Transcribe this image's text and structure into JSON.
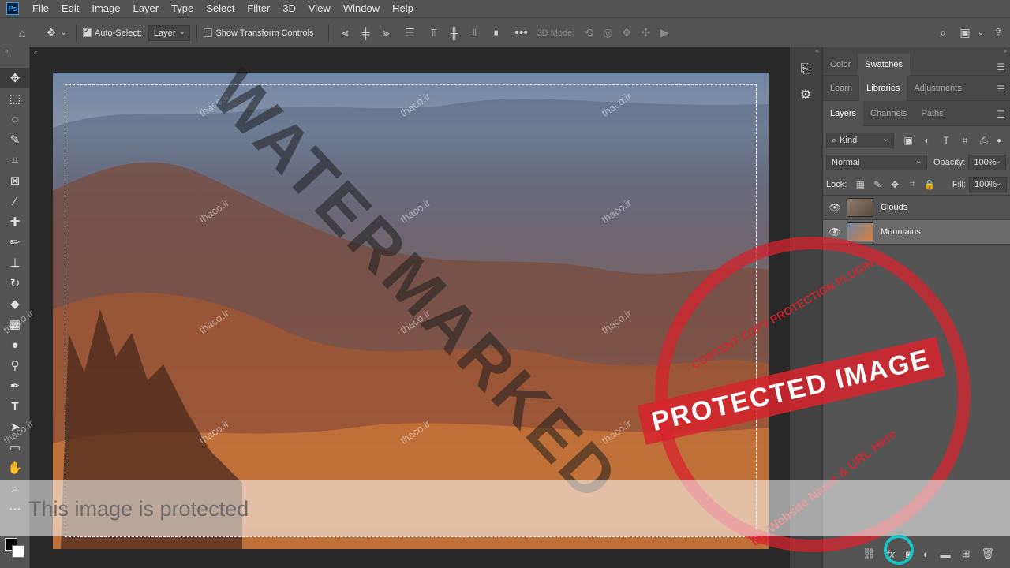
{
  "app": {
    "logo": "Ps"
  },
  "menu": [
    "File",
    "Edit",
    "Image",
    "Layer",
    "Type",
    "Select",
    "Filter",
    "3D",
    "View",
    "Window",
    "Help"
  ],
  "options": {
    "auto_select_label": "Auto-Select:",
    "auto_select_value": "Layer",
    "show_transform_label": "Show Transform Controls",
    "mode_label": "3D Mode:"
  },
  "panels": {
    "top_tabs": [
      "Color",
      "Swatches"
    ],
    "mid_tabs": [
      "Learn",
      "Libraries",
      "Adjustments"
    ],
    "layer_tabs": [
      "Layers",
      "Channels",
      "Paths"
    ],
    "filter_kind": "Kind",
    "blend_mode": "Normal",
    "opacity_label": "Opacity:",
    "opacity_value": "100%",
    "lock_label": "Lock:",
    "fill_label": "Fill:",
    "fill_value": "100%",
    "layers": [
      {
        "name": "Clouds"
      },
      {
        "name": "Mountains"
      }
    ]
  },
  "overlay": {
    "protected_text": "This image is protected",
    "watermark": "WATERMARKED",
    "thaco": "thaco.ir",
    "stamp_main": "PROTECTED IMAGE",
    "stamp_top": "CONTENT COPY PROTECTION PLUGIN",
    "stamp_bottom": "My Website Name & URL Here"
  }
}
